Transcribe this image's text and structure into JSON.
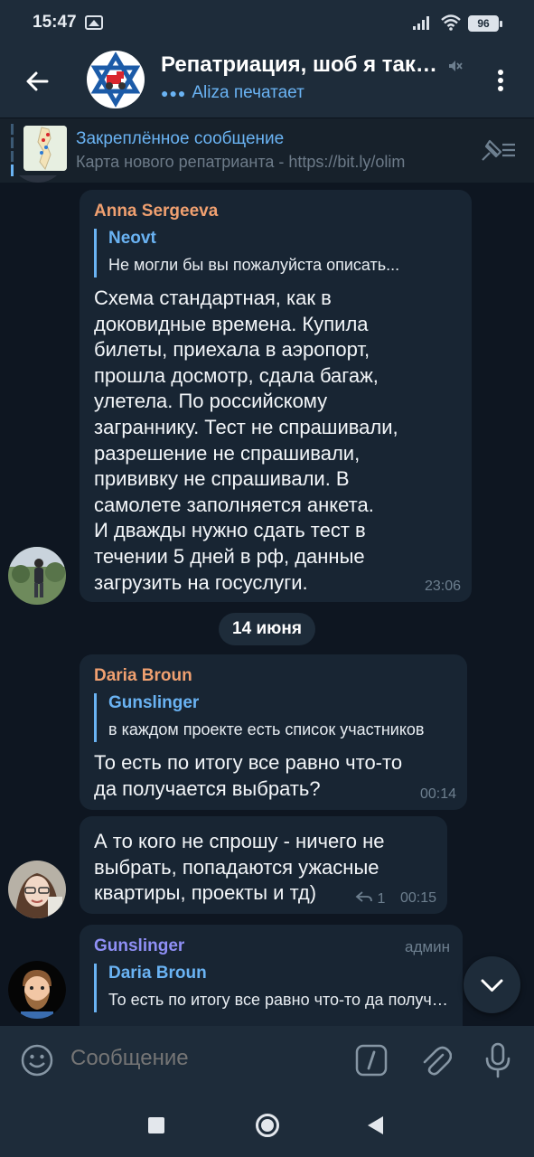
{
  "status_bar": {
    "time": "15:47",
    "battery": "96"
  },
  "chat": {
    "title": "Репатриация, шоб я так жил",
    "typing_user": "Aliza",
    "typing_text": "печатает"
  },
  "pinned": {
    "title": "Закреплённое сообщение",
    "text": "Карта нового репатрианта - https://bit.ly/olim"
  },
  "messages": [
    {
      "sender": "Anna Sergeeva",
      "sender_color": "#f0a070",
      "reply_name": "Neovt",
      "reply_text": "Не могли бы вы пожалуйста описать...",
      "lines": [
        "Схема стандартная, как в",
        "доковидные времена. Купила",
        "билеты, приехала в аэропорт,",
        "прошла досмотр, сдала багаж,",
        "улетела. По российскому",
        "заграннику. Тест не спрашивали,",
        "разрешение не спрашивали,",
        "прививку не спрашивали. В",
        "самолете заполняется анкета.",
        "И дважды нужно сдать тест в",
        "течении 5 дней в рф, данные",
        "загрузить на госуслуги."
      ],
      "time": "23:06"
    },
    {
      "sender": "Daria Broun",
      "sender_color": "#f0a070",
      "reply_name": "Gunslinger",
      "reply_text": "в каждом проекте есть список участников",
      "lines": [
        "То есть по итогу все равно что-то",
        "да получается выбрать?"
      ],
      "time": "00:14"
    },
    {
      "lines": [
        "А то кого не спрошу - ничего не",
        "выбрать, попадаются ужасные",
        "квартиры, проекты и тд)"
      ],
      "replies": "1",
      "time": "00:15"
    },
    {
      "sender": "Gunslinger",
      "sender_color": "#8f8ff5",
      "role": "админ",
      "reply_name": "Daria Broun",
      "reply_text": "То есть по итогу все равно что-то да получается"
    }
  ],
  "date_separator": "14 июня",
  "input": {
    "placeholder": "Сообщение"
  },
  "icons": [
    "back-arrow-icon",
    "mute-icon",
    "more-vertical-icon",
    "unpin-icon",
    "emoji-icon",
    "bot-command-icon",
    "attach-icon",
    "mic-icon",
    "chevron-down-icon",
    "reply-count-icon"
  ],
  "colors": {
    "background": "#0e1621",
    "header": "#1e2c3a",
    "bubble": "#182533",
    "accent": "#6ab3f3"
  }
}
